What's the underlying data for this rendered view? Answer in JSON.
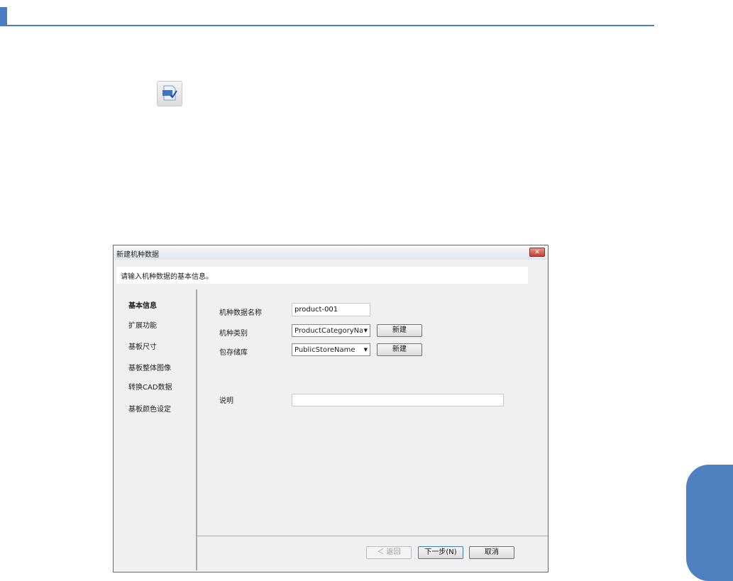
{
  "dialog": {
    "title": "新建机种数据",
    "close_label": "✕",
    "instruction": "请输入机种数据的基本信息。",
    "nav": [
      {
        "label": "基本信息"
      },
      {
        "label": "扩展功能"
      },
      {
        "label": "基板尺寸"
      },
      {
        "label": "基板整体图像"
      },
      {
        "label": "转换CAD数据"
      },
      {
        "label": "基板颜色设定"
      }
    ],
    "fields": {
      "name": {
        "label": "机种数据名称",
        "value": "product-001"
      },
      "category": {
        "label": "机种类别",
        "value": "ProductCategoryName"
      },
      "store": {
        "label": "包存储库",
        "value": "PublicStoreName"
      },
      "description": {
        "label": "说明",
        "value": ""
      }
    },
    "new_button_label": "新建",
    "footer": {
      "back": "＜ 返回",
      "next": "下一步(N)",
      "cancel": "取消"
    }
  },
  "icons": {
    "doc_icon": "svt-document-icon",
    "dropdown": "chevron-down-icon"
  }
}
